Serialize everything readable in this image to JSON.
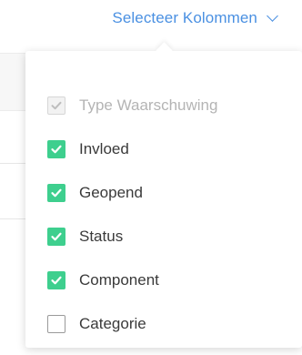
{
  "header": {
    "trigger_label": "Selecteer Kolommen"
  },
  "columns": [
    {
      "label": "Type Waarschuwing",
      "state": "disabled-checked"
    },
    {
      "label": "Invloed",
      "state": "checked"
    },
    {
      "label": "Geopend",
      "state": "checked"
    },
    {
      "label": "Status",
      "state": "checked"
    },
    {
      "label": "Component",
      "state": "checked"
    },
    {
      "label": "Categorie",
      "state": "unchecked"
    }
  ],
  "colors": {
    "accent_link": "#4a90e2",
    "checkbox_checked": "#3ecf8e",
    "checkbox_disabled": "#f2f2f2",
    "text": "#3a3a3a",
    "text_disabled": "#b4b4b4"
  },
  "icons": {
    "trigger": "chevron-down-icon",
    "check": "checkmark-icon"
  }
}
